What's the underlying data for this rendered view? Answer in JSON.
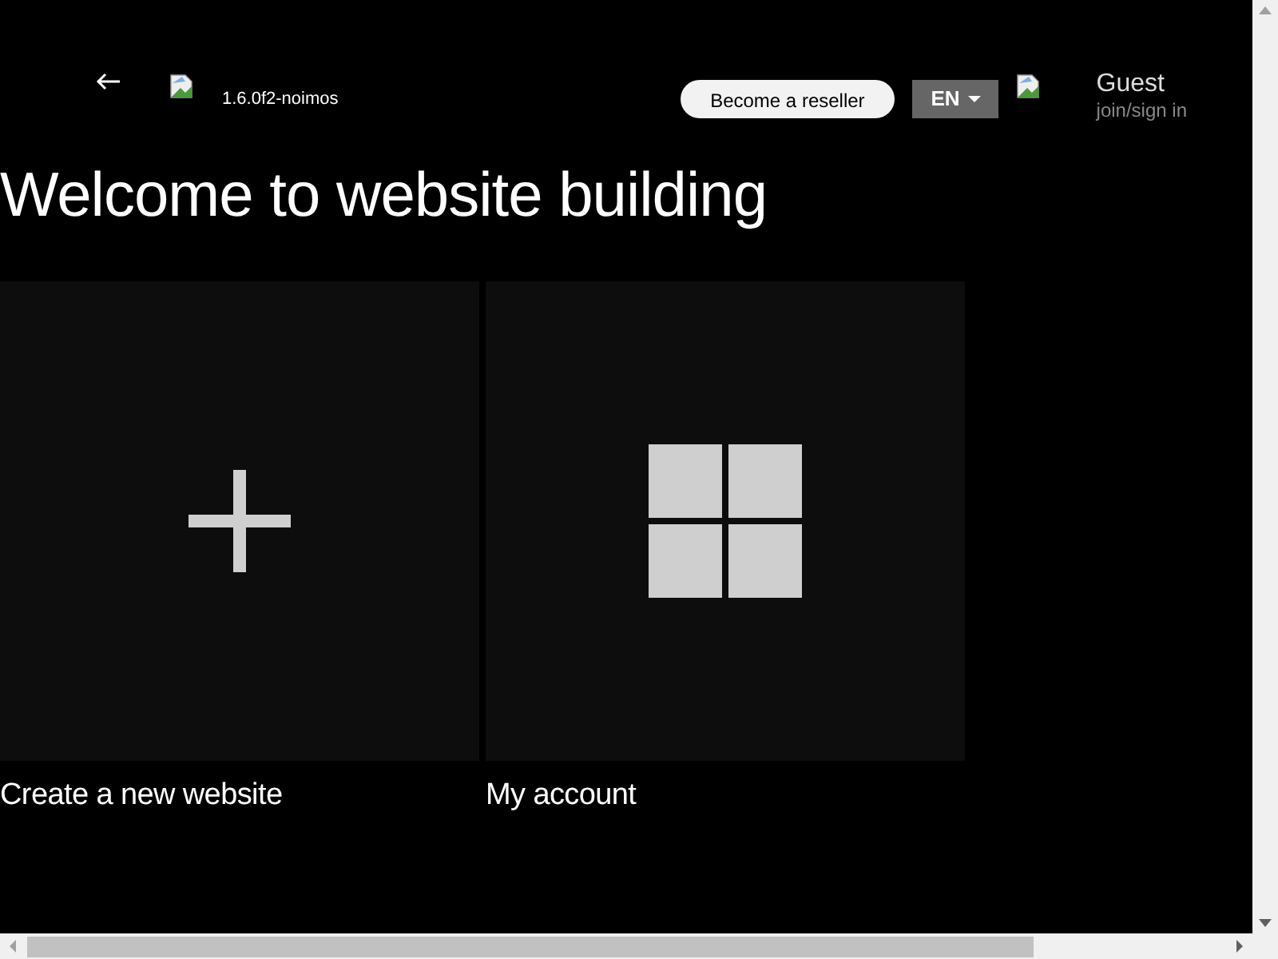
{
  "header": {
    "version": "1.6.0f2-noimos",
    "reseller_button": "Become a reseller",
    "language": "EN",
    "user": {
      "name": "Guest",
      "link": "join/sign in"
    }
  },
  "title": "Welcome to website building",
  "tiles": [
    {
      "kind": "plus",
      "label": "Create a new website"
    },
    {
      "kind": "grid",
      "label": "My account"
    }
  ]
}
